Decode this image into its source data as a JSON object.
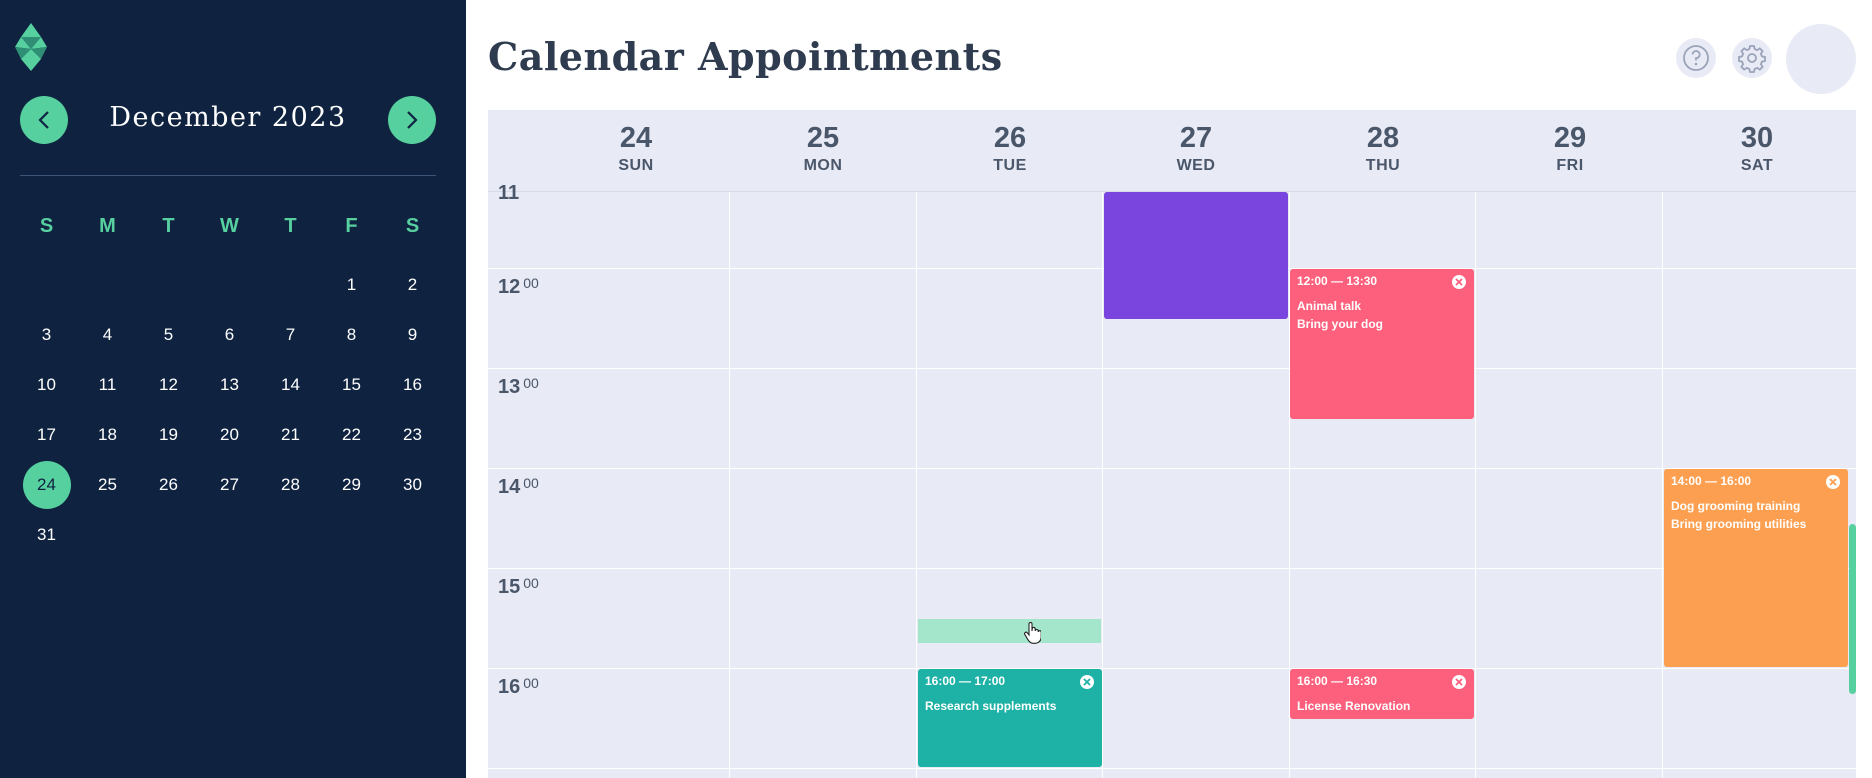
{
  "sidebar": {
    "month_label": "December 2023",
    "weekday_headers": [
      "S",
      "M",
      "T",
      "W",
      "T",
      "F",
      "S"
    ],
    "weeks": [
      [
        "",
        "",
        "",
        "",
        "",
        "1",
        "2"
      ],
      [
        "3",
        "4",
        "5",
        "6",
        "7",
        "8",
        "9"
      ],
      [
        "10",
        "11",
        "12",
        "13",
        "14",
        "15",
        "16"
      ],
      [
        "17",
        "18",
        "19",
        "20",
        "21",
        "22",
        "23"
      ],
      [
        "24",
        "25",
        "26",
        "27",
        "28",
        "29",
        "30"
      ],
      [
        "31",
        "",
        "",
        "",
        "",
        "",
        ""
      ]
    ],
    "selected_day": "24"
  },
  "header": {
    "title": "Calendar Appointments"
  },
  "calendar": {
    "days": [
      {
        "num": "24",
        "name": "SUN"
      },
      {
        "num": "25",
        "name": "MON"
      },
      {
        "num": "26",
        "name": "TUE"
      },
      {
        "num": "27",
        "name": "WED"
      },
      {
        "num": "28",
        "name": "THU"
      },
      {
        "num": "29",
        "name": "FRI"
      },
      {
        "num": "30",
        "name": "SAT"
      }
    ],
    "partial_hour_label": "11",
    "hours": [
      {
        "h": "12",
        "m": "00"
      },
      {
        "h": "13",
        "m": "00"
      },
      {
        "h": "14",
        "m": "00"
      },
      {
        "h": "15",
        "m": "00"
      },
      {
        "h": "16",
        "m": "00"
      }
    ],
    "events": [
      {
        "id": "wed-purple",
        "day_index": 3,
        "time": "",
        "lines": [],
        "color": "#7a44de",
        "closable": false
      },
      {
        "id": "animal-talk",
        "day_index": 4,
        "time": "12:00 — 13:30",
        "lines": [
          "Animal talk",
          "Bring your dog"
        ],
        "color": "#fd607c",
        "closable": true
      },
      {
        "id": "dog-grooming",
        "day_index": 5,
        "time": "14:00 — 16:00",
        "lines": [
          "Dog grooming training",
          "Bring grooming utilities"
        ],
        "color": "#fd9f51",
        "closable": true
      },
      {
        "id": "research",
        "day_index": 2,
        "time": "16:00 — 17:00",
        "lines": [
          "Research supplements"
        ],
        "color": "#1eb2a6",
        "closable": true
      },
      {
        "id": "license",
        "day_index": 4,
        "time": "16:00 — 16:30",
        "lines": [
          "License Renovation"
        ],
        "color": "#fd607c",
        "closable": true
      }
    ]
  },
  "colors": {
    "sidebar_bg": "#0f2340",
    "accent": "#57d0a0",
    "grid_bg": "#e8ebf6",
    "drag_preview": "#a3e6cb"
  }
}
